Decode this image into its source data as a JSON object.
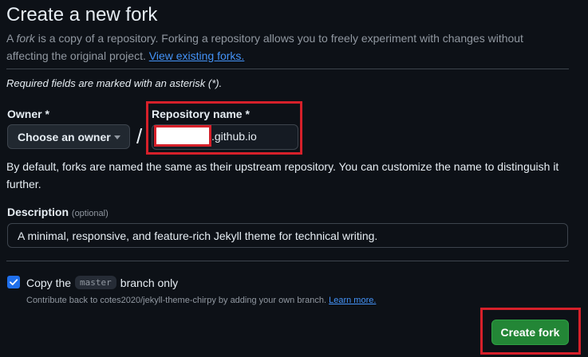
{
  "header": {
    "title": "Create a new fork",
    "intro_word": "fork",
    "intro_prefix": "A ",
    "intro_rest": " is a copy of a repository. Forking a repository allows you to freely experiment with changes without affecting the original project. ",
    "view_forks_link": "View existing forks."
  },
  "form": {
    "required_note": "Required fields are marked with an asterisk (*).",
    "owner": {
      "label": "Owner *",
      "button_label": "Choose an owner"
    },
    "separator": "/",
    "repository": {
      "label": "Repository name *",
      "value_suffix": ".github.io"
    },
    "helper_text": "By default, forks are named the same as their upstream repository. You can customize the name to distinguish it further.",
    "description": {
      "label": "Description",
      "optional_tag": "(optional)",
      "value": "A minimal, responsive, and feature-rich Jekyll theme for technical writing."
    },
    "copy_branch": {
      "checked": true,
      "prefix": "Copy the",
      "branch": "master",
      "suffix": "branch only",
      "note": "Contribute back to cotes2020/jekyll-theme-chirpy by adding your own branch.",
      "learn_more": "Learn more."
    },
    "submit_label": "Create fork"
  },
  "colors": {
    "background": "#0d1117",
    "accent_link": "#4493f8",
    "primary_button": "#238636",
    "annotation_red": "#d6202a",
    "checkbox": "#1f6feb"
  }
}
